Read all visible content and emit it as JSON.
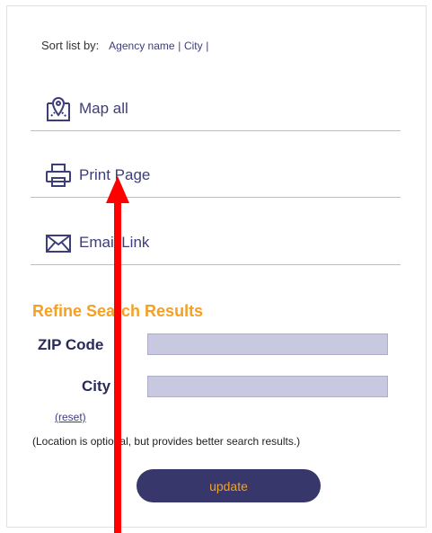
{
  "sort": {
    "label": "Sort list by:",
    "options": [
      "Agency name",
      "City"
    ],
    "separator": "|"
  },
  "actions": {
    "map_all": "Map all",
    "print_page": "Print Page",
    "email_link": "Email Link"
  },
  "refine": {
    "title": "Refine Search Results",
    "zip_label": "ZIP Code",
    "zip_value": "",
    "city_label": "City",
    "city_value": "",
    "reset": "(reset)",
    "note": "(Location is optional, but provides better search results.)",
    "update": "update"
  },
  "colors": {
    "accent": "#f5a023",
    "brand": "#37376b",
    "link": "#3d3d7a",
    "input_bg": "#c8c8e0",
    "annotation_arrow": "#ff0000"
  },
  "icons": {
    "map": "map-pin-icon",
    "print": "printer-icon",
    "email": "envelope-icon"
  }
}
